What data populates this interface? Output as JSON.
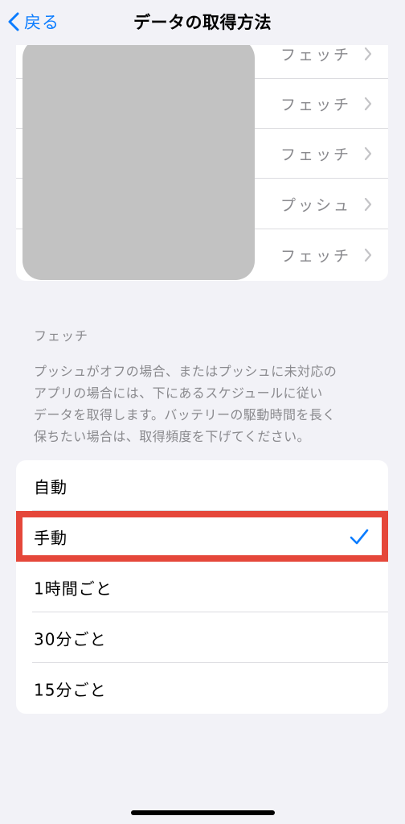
{
  "nav": {
    "back_label": "戻る",
    "title": "データの取得方法"
  },
  "accounts": [
    {
      "value": "フェッチ"
    },
    {
      "value": "フェッチ"
    },
    {
      "value": "フェッチ"
    },
    {
      "value": "プッシュ"
    },
    {
      "value": "フェッチ"
    }
  ],
  "fetch_section": {
    "header": "フェッチ",
    "footer_lines": [
      "プッシュがオフの場合、またはプッシュに未対応の",
      "アプリの場合には、下にあるスケジュールに従い",
      "データを取得します。バッテリーの駆動時間を長く",
      "保ちたい場合は、取得頻度を下げてください。"
    ],
    "options": [
      {
        "label": "自動",
        "selected": false
      },
      {
        "label": "手動",
        "selected": true
      },
      {
        "label": "1時間ごと",
        "selected": false
      },
      {
        "label": "30分ごと",
        "selected": false
      },
      {
        "label": "15分ごと",
        "selected": false
      }
    ]
  },
  "colors": {
    "accent": "#0a7cff",
    "highlight": "#e5473a",
    "secondary_text": "#8a8a8e",
    "background": "#f2f2f7"
  },
  "icons": {
    "back": "chevron-left-icon",
    "row": "chevron-right-icon",
    "selected": "checkmark-icon"
  }
}
